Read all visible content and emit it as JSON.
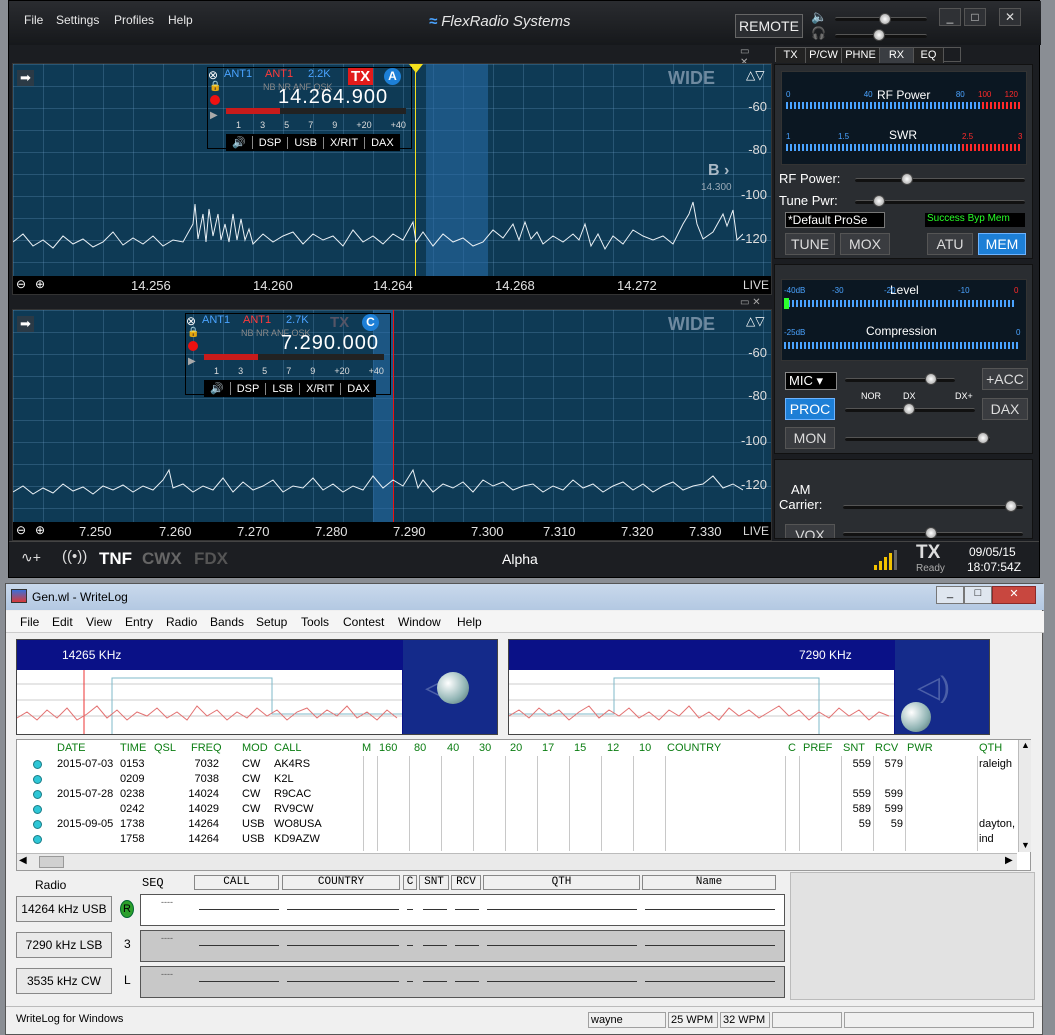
{
  "sdr": {
    "menu": [
      "File",
      "Settings",
      "Profiles",
      "Help"
    ],
    "logo": "FlexRadio Systems",
    "remote": "REMOTE",
    "tabs": [
      "TX",
      "P/CW",
      "PHNE",
      "RX",
      "EQ"
    ],
    "pan1": {
      "ant1": "ANT1",
      "ant2": "ANT1",
      "bw": "2.2K",
      "tx": "TX",
      "slice_letter": "A",
      "flags": "NB NR ANF OSK",
      "freq": "14.264.900",
      "scale": [
        "1",
        "3",
        "5",
        "7",
        "9",
        "+20",
        "+40"
      ],
      "buttons": [
        "DSP",
        "USB",
        "X/RIT",
        "DAX"
      ],
      "mode": "WIDE",
      "db": [
        "-60",
        "-80",
        "-100",
        "-120"
      ],
      "freqs": [
        "14.256",
        "14.260",
        "14.264",
        "14.268",
        "14.272"
      ],
      "live": "LIVE",
      "b_label": "B",
      "b_freq": "14.300"
    },
    "pan2": {
      "ant1": "ANT1",
      "ant2": "ANT1",
      "bw": "2.7K",
      "tx": "TX",
      "slice_letter": "C",
      "flags": "NB NR ANF OSK",
      "freq": "7.290.000",
      "scale": [
        "1",
        "3",
        "5",
        "7",
        "9",
        "+20",
        "+40"
      ],
      "buttons": [
        "DSP",
        "LSB",
        "X/RIT",
        "DAX"
      ],
      "mode": "WIDE",
      "db": [
        "-60",
        "-80",
        "-100",
        "-120"
      ],
      "freqs": [
        "7.250",
        "7.260",
        "7.270",
        "7.280",
        "7.290",
        "7.300",
        "7.310",
        "7.320",
        "7.330"
      ],
      "live": "LIVE"
    },
    "tx_panel": {
      "rf_power_title": "RF Power",
      "rf_scale": [
        "0",
        "40",
        "80",
        "100",
        "120"
      ],
      "swr_title": "SWR",
      "swr_scale": [
        "1",
        "1.5",
        "2.5",
        "3"
      ],
      "rf_power_label": "RF Power:",
      "tune_pwr_label": "Tune Pwr:",
      "profile": "*Default ProSe",
      "status": "Success  Byp  Mem",
      "tune": "TUNE",
      "mox": "MOX",
      "atu": "ATU",
      "mem": "MEM"
    },
    "phone_panel": {
      "level_title": "Level",
      "level_scale": [
        "-40dB",
        "-30",
        "-20",
        "-10",
        "0"
      ],
      "comp_title": "Compression",
      "comp_scale": [
        "-25dB",
        "0"
      ],
      "mic": "MIC",
      "acc": "+ACC",
      "nor": "NOR",
      "dx": "DX",
      "dxp": "DX+",
      "proc": "PROC",
      "dax": "DAX",
      "mon": "MON"
    },
    "am_panel": {
      "am": "AM",
      "carrier": "Carrier:",
      "vox": "VOX"
    },
    "status": {
      "tnf": "TNF",
      "cwx": "CWX",
      "fdx": "FDX",
      "station": "Alpha",
      "tx": "TX",
      "ready": "Ready",
      "date": "09/05/15",
      "time": "18:07:54Z"
    }
  },
  "wl": {
    "title": "Gen.wl - WriteLog",
    "menu": [
      "File",
      "Edit",
      "View",
      "Entry",
      "Radio",
      "Bands",
      "Setup",
      "Tools",
      "Contest",
      "Window",
      "Help"
    ],
    "band1": "14265 KHz",
    "band2": "7290 KHz",
    "headers": [
      "DATE",
      "TIME",
      "QSL",
      "FREQ",
      "MOD",
      "CALL",
      "M",
      "160",
      "80",
      "40",
      "30",
      "20",
      "17",
      "15",
      "12",
      "10",
      "COUNTRY",
      "C",
      "PREF",
      "SNT",
      "RCV",
      "PWR",
      "QTH"
    ],
    "rows": [
      {
        "date": "2015-07-03",
        "time": "0153",
        "freq": "7032",
        "mod": "CW",
        "call": "AK4RS",
        "snt": "559",
        "rcv": "579",
        "qth": "raleigh"
      },
      {
        "date": "",
        "time": "0209",
        "freq": "7038",
        "mod": "CW",
        "call": "K2L",
        "snt": "",
        "rcv": "",
        "qth": ""
      },
      {
        "date": "2015-07-28",
        "time": "0238",
        "freq": "14024",
        "mod": "CW",
        "call": "R9CAC",
        "snt": "559",
        "rcv": "599",
        "qth": ""
      },
      {
        "date": "",
        "time": "0242",
        "freq": "14029",
        "mod": "CW",
        "call": "RV9CW",
        "snt": "589",
        "rcv": "599",
        "qth": ""
      },
      {
        "date": "2015-09-05",
        "time": "1738",
        "freq": "14264",
        "mod": "USB",
        "call": "WO8USA",
        "snt": "59",
        "rcv": "59",
        "qth": "dayton,"
      },
      {
        "date": "",
        "time": "1758",
        "freq": "14264",
        "mod": "USB",
        "call": "KD9AZW",
        "snt": "",
        "rcv": "",
        "qth": "ind"
      }
    ],
    "entry": {
      "radio": "Radio",
      "seq": "SEQ",
      "cols": [
        "CALL",
        "COUNTRY",
        "C",
        "SNT",
        "RCV",
        "QTH",
        "Name"
      ],
      "radios": [
        {
          "label": "14264 kHz USB",
          "seq": "R"
        },
        {
          "label": "7290 kHz LSB",
          "seq": "3"
        },
        {
          "label": "3535 kHz CW",
          "seq": "L"
        }
      ]
    },
    "status": {
      "app": "WriteLog for Windows",
      "user": "wayne",
      "wpm1": "25 WPM",
      "wpm2": "32 WPM"
    }
  }
}
